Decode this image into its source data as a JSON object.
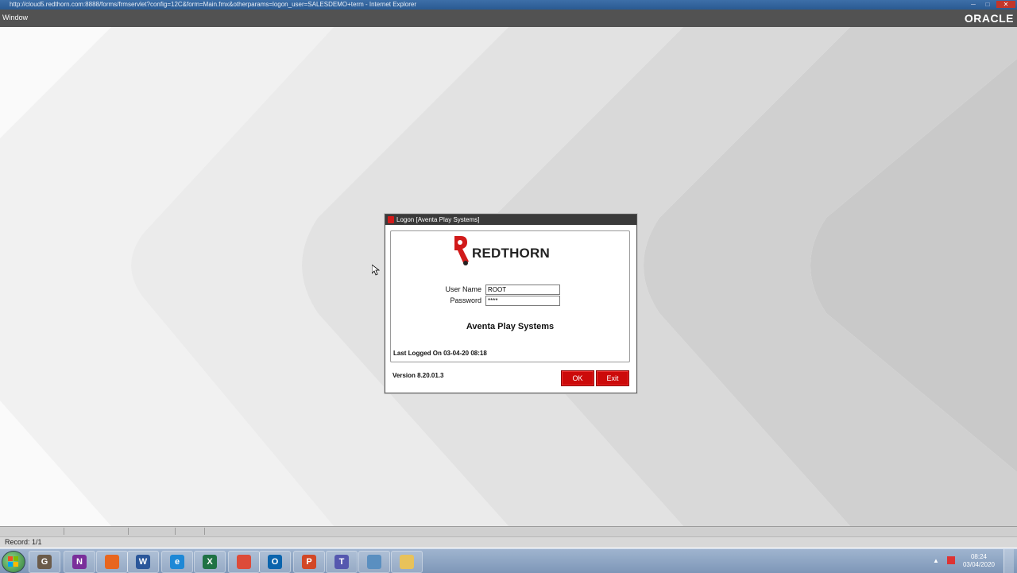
{
  "window": {
    "title": "http://cloud5.redthorn.com:8888/forms/frmservlet?config=12C&form=Main.fmx&otherparams=logon_user=SALESDEMO+term - Internet Explorer",
    "minimize_glyph": "─",
    "maximize_glyph": "□",
    "close_glyph": "✕"
  },
  "menubar": {
    "menu_label": "Window",
    "brand": "ORACLE"
  },
  "dialog": {
    "title": "Logon [Aventa Play Systems]",
    "logo_text": "REDTHORN",
    "username_label": "User Name",
    "username_value": "ROOT",
    "password_label": "Password",
    "password_value": "****",
    "company": "Aventa Play Systems",
    "last_logged": "Last Logged On 03-04-20 08:18",
    "version": "Version 8.20.01.3",
    "ok_label": "OK",
    "exit_label": "Exit"
  },
  "status": {
    "record": "Record: 1/1"
  },
  "taskbar": {
    "apps": [
      {
        "icon": "gimp-icon",
        "glyph": "G",
        "color": "#6b5b4a"
      },
      {
        "icon": "onenote-icon",
        "glyph": "N",
        "color": "#7a2f9a"
      },
      {
        "icon": "firefox-icon",
        "glyph": "",
        "color": "#e8661e"
      },
      {
        "icon": "word-icon",
        "glyph": "W",
        "color": "#2b579a"
      },
      {
        "icon": "internet-explorer-icon",
        "glyph": "e",
        "color": "#1e88d6"
      },
      {
        "icon": "excel-icon",
        "glyph": "X",
        "color": "#1f7244"
      },
      {
        "icon": "chrome-icon",
        "glyph": "",
        "color": "#dd4b39"
      },
      {
        "icon": "outlook-icon",
        "glyph": "O",
        "color": "#0a64ad"
      },
      {
        "icon": "powerpoint-icon",
        "glyph": "P",
        "color": "#d24726"
      },
      {
        "icon": "teams-icon",
        "glyph": "T",
        "color": "#5558af"
      },
      {
        "icon": "app-window-icon",
        "glyph": "",
        "color": "#5a8fc0"
      },
      {
        "icon": "file-explorer-icon",
        "glyph": "",
        "color": "#e8c25a"
      }
    ],
    "time": "08:24",
    "date": "03/04/2020",
    "tray_up_glyph": "▲"
  }
}
